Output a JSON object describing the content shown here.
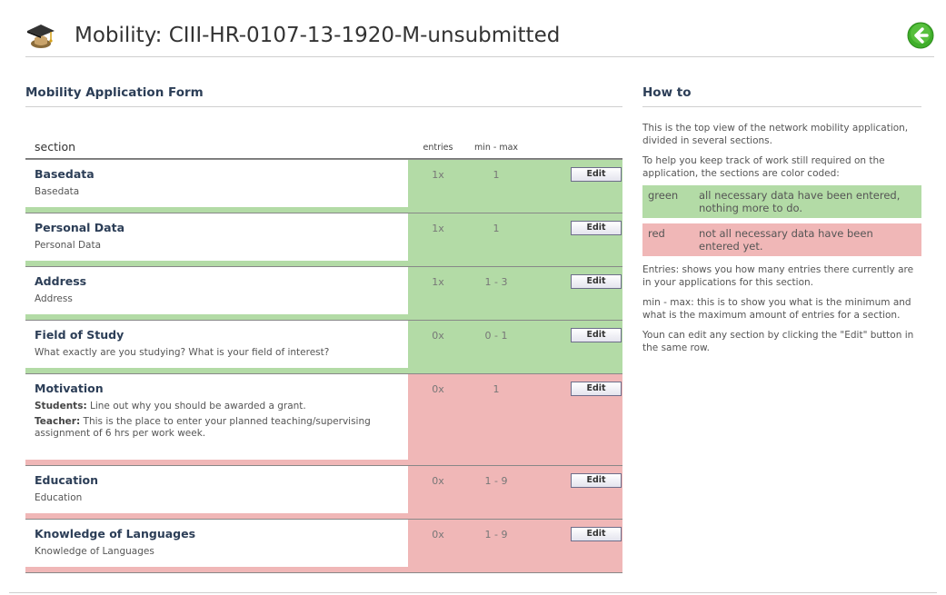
{
  "header": {
    "title": "Mobility: CIII-HR-0107-13-1920-M-unsubmitted",
    "icon": "graduation-cap-icon",
    "back_icon": "back-arrow-icon"
  },
  "form": {
    "heading": "Mobility Application Form",
    "columns": {
      "section": "section",
      "entries": "entries",
      "minmax": "min - max"
    },
    "edit_label": "Edit",
    "rows": [
      {
        "title": "Basedata",
        "desc": "Basedata",
        "entries": "1x",
        "minmax": "1",
        "status": "green"
      },
      {
        "title": "Personal Data",
        "desc": "Personal Data",
        "entries": "1x",
        "minmax": "1",
        "status": "green"
      },
      {
        "title": "Address",
        "desc": "Address",
        "entries": "1x",
        "minmax": "1 - 3",
        "status": "green"
      },
      {
        "title": "Field of Study",
        "desc": "What exactly are you studying? What is your field of interest?",
        "entries": "0x",
        "minmax": "0 - 1",
        "status": "green"
      },
      {
        "title": "Motivation",
        "students_label": "Students:",
        "students_text": " Line out why you should be awarded a grant.",
        "teacher_label": "Teacher:",
        "teacher_text": " This is the place to enter your planned teaching/supervising assignment of 6 hrs per work week.",
        "entries": "0x",
        "minmax": "1",
        "status": "red"
      },
      {
        "title": "Education",
        "desc": "Education",
        "entries": "0x",
        "minmax": "1 - 9",
        "status": "red"
      },
      {
        "title": "Knowledge of Languages",
        "desc": "Knowledge of Languages",
        "entries": "0x",
        "minmax": "1 - 9",
        "status": "red"
      }
    ]
  },
  "howto": {
    "heading": "How to",
    "intro": "This is the top view of the network mobility application, divided in several sections.",
    "tracking": "To help you keep track of work still required on the application, the sections are color coded:",
    "legend": [
      {
        "key": "green",
        "text": "all necessary data have been entered, nothing more to do."
      },
      {
        "key": "red",
        "text": "not all necessary data have been entered yet."
      }
    ],
    "entries_note": "Entries: shows you how many entries there currently are in your applications for this section.",
    "minmax_note": "min - max: this is to show you what is the minimum and what is the maximum amount of entries for a section.",
    "edit_note": "Youn can edit any section by clicking the \"Edit\" button in the same row."
  },
  "colors": {
    "green": "#b3dba6",
    "red": "#f0b7b7",
    "heading": "#2c3e57"
  }
}
